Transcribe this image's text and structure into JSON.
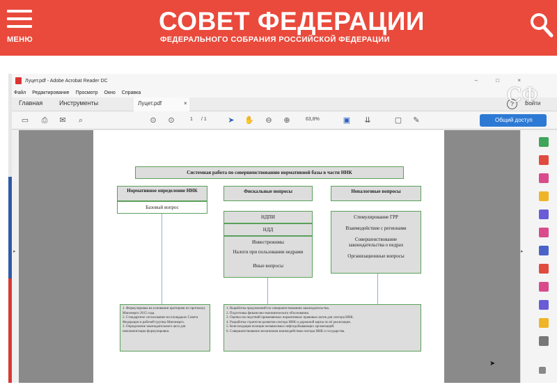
{
  "site": {
    "menu_label": "МЕНЮ",
    "title": "СОВЕТ ФЕДЕРАЦИИ",
    "subtitle": "ФЕДЕРАЛЬНОГО СОБРАНИЯ РОССИЙСКОЙ ФЕДЕРАЦИИ",
    "brand_color": "#e94a3c",
    "search_icon": "search-icon",
    "logo_text": "СФ"
  },
  "window": {
    "title": "Луцет.pdf - Adobe Acrobat Reader DC",
    "controls": "– □ ×"
  },
  "menubar": [
    "Файл",
    "Редактирование",
    "Просмотр",
    "Окно",
    "Справка"
  ],
  "tabs": {
    "home": "Главная",
    "tools": "Инструменты",
    "doc": "Луцет.pdf",
    "close": "×",
    "help": "?",
    "signin": "Войти"
  },
  "toolbar": {
    "page_current": "1",
    "page_total": "/ 1",
    "zoom": "63,8%",
    "share_label": "Общий доступ",
    "accent": "#2d7ad5"
  },
  "diagram": {
    "title": "Системная работа по совершенствованию нормативной базы в части ННК",
    "col1_header": "Нормативное определение ННК",
    "col1_item": "Базовый вопрос",
    "col2_header": "Фискальные вопросы",
    "col2_items": [
      "НДПИ",
      "НДД",
      "Инвестрежимы",
      "Налоги при пользовании недрами",
      "Иные вопросы"
    ],
    "col3_header": "Неналоговые вопросы",
    "col3_items": [
      "Стимулирование ГРР",
      "Взаимодействие с регионами",
      "Совершенствование законодательства о недрах",
      "Организационные вопросы"
    ],
    "notes1": [
      "1. Формулировка на основании критериев по протоколу Минэнерго 2015 года.",
      "2. Стандартное согласование на площадках Совета Федерации и рабочей группы Минэнерго.",
      "3. Определение законодательного акта для имплементации формулировки."
    ],
    "notes2": [
      "1. Выработка предложений по совершенствованию законодательства.",
      "2. Подготовка финансово-экономического обоснования.",
      "3. Оценка последствий применяемых нормативных правовых актов для сектора ННК.",
      "4. Разработка стратегии развития сектора ННК и дорожной карты по её реализации.",
      "5. Консолидация позиции независимых нефтедобывающих организаций.",
      "6. Совершенствование механизмов взаимодействия сектора ННК и государства."
    ]
  }
}
